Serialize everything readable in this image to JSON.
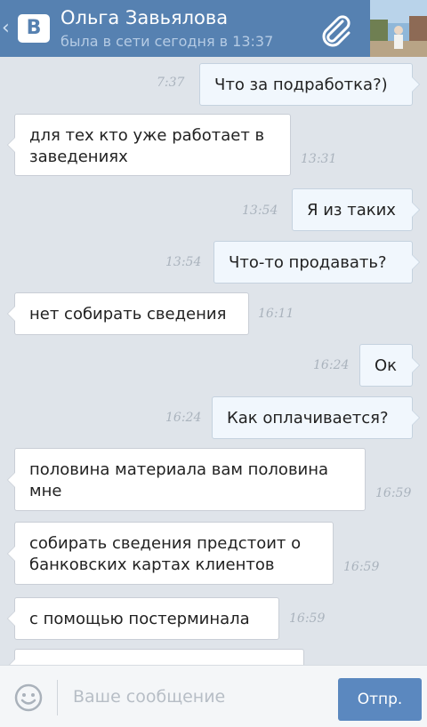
{
  "header": {
    "contact_name": "Ольга Завьялова",
    "status": "была в сети сегодня в 13:37",
    "logo_text": "B",
    "back_glyph": "‹"
  },
  "messages": [
    {
      "direction": "out",
      "text": "Что за подработка?)",
      "time": "7:37"
    },
    {
      "direction": "in",
      "text": "для тех кто уже работает в заведениях",
      "time": "13:31"
    },
    {
      "direction": "out",
      "text": "Я из таких",
      "time": "13:54"
    },
    {
      "direction": "out",
      "text": "Что-то продавать?",
      "time": "13:54"
    },
    {
      "direction": "in",
      "text": "нет собирать сведения",
      "time": "16:11"
    },
    {
      "direction": "out",
      "text": "Ок",
      "time": "16:24"
    },
    {
      "direction": "out",
      "text": "Как оплачивается?",
      "time": "16:24"
    },
    {
      "direction": "in",
      "text": "половина материала вам половина мне",
      "time": "16:59"
    },
    {
      "direction": "in",
      "text": "собирать сведения предстоит о банковских картах клиентов",
      "time": "16:59"
    },
    {
      "direction": "in",
      "text": "с помощью постерминала",
      "time": "16:59"
    }
  ],
  "composer": {
    "placeholder": "Ваше сообщение",
    "send_label": "Отпр."
  },
  "colors": {
    "header": "#5681b1",
    "chat_bg": "#dfe4ea",
    "incoming_bubble": "#ffffff",
    "outgoing_bubble": "#f1f7fd",
    "send_button": "#5b88bf"
  },
  "icons": [
    "back-arrow-icon",
    "vk-logo",
    "attachment-paperclip-icon",
    "contact-avatar",
    "smile-icon"
  ]
}
